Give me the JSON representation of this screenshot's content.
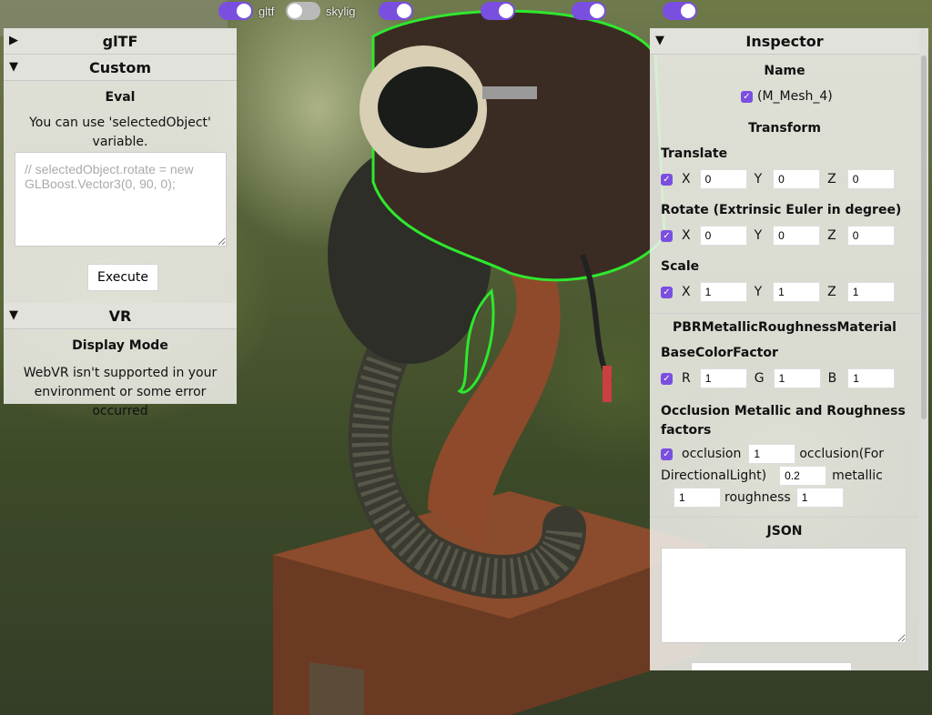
{
  "toggles": [
    {
      "label": "gltf",
      "on": true
    },
    {
      "label": "skylig",
      "on": false
    },
    {
      "label": "",
      "on": true
    },
    {
      "label": "",
      "on": true
    },
    {
      "label": "",
      "on": true
    },
    {
      "label": "",
      "on": true
    }
  ],
  "left": {
    "gltf": {
      "title": "glTF",
      "arrow": "▶"
    },
    "custom": {
      "title": "Custom",
      "arrow": "▼",
      "eval_label": "Eval",
      "hint": "You can use 'selectedObject' variable.",
      "code_placeholder": "// selectedObject.rotate = new GLBoost.Vector3(0, 90, 0);",
      "execute_label": "Execute"
    },
    "vr": {
      "title": "VR",
      "arrow": "▼",
      "display_mode_label": "Display Mode",
      "message": "WebVR isn't supported in your environment or some error occurred"
    }
  },
  "inspector": {
    "title": "Inspector",
    "arrow": "▼",
    "name_label": "Name",
    "mesh_name": "(M_Mesh_4)",
    "transform_label": "Transform",
    "translate": {
      "label": "Translate",
      "x": "0",
      "y": "0",
      "z": "0"
    },
    "rotate": {
      "label": "Rotate (Extrinsic Euler in degree)",
      "x": "0",
      "y": "0",
      "z": "0"
    },
    "scale": {
      "label": "Scale",
      "x": "1",
      "y": "1",
      "z": "1"
    },
    "axis": {
      "x": "X",
      "y": "Y",
      "z": "Z",
      "r": "R",
      "g": "G",
      "b": "B"
    },
    "material_label": "PBRMetallicRoughnessMaterial",
    "base_color": {
      "label": "BaseColorFactor",
      "r": "1",
      "g": "1",
      "b": "1"
    },
    "oms": {
      "label": "Occlusion Metallic and Roughness factors",
      "occlusion_label": "occlusion",
      "occlusion": "1",
      "occlusion_dir_label_1": "occlusion(For",
      "occlusion_dir_label_2": "DirectionalLight)",
      "occlusion_dir": "0.2",
      "metallic_label": "metallic",
      "metallic": "1",
      "roughness_label": "roughness",
      "roughness": "1"
    },
    "json_label": "JSON"
  },
  "colors": {
    "accent": "#7a4fe0",
    "outline": "#2ee82e"
  }
}
